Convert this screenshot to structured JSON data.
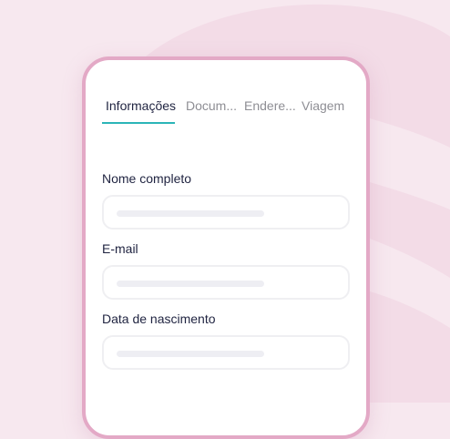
{
  "tabs": [
    {
      "label": "Informações",
      "active": true
    },
    {
      "label": "Docum..."
    },
    {
      "label": "Endere..."
    },
    {
      "label": "Viagem"
    }
  ],
  "fields": [
    {
      "label": "Nome completo"
    },
    {
      "label": "E-mail"
    },
    {
      "label": "Data de nascimento"
    }
  ],
  "colors": {
    "background": "#f7e8ef",
    "phone_border": "#e3a9c6",
    "tab_accent": "#2bb5b8",
    "text_dark": "#1f2340",
    "text_muted": "#8e8e94"
  }
}
